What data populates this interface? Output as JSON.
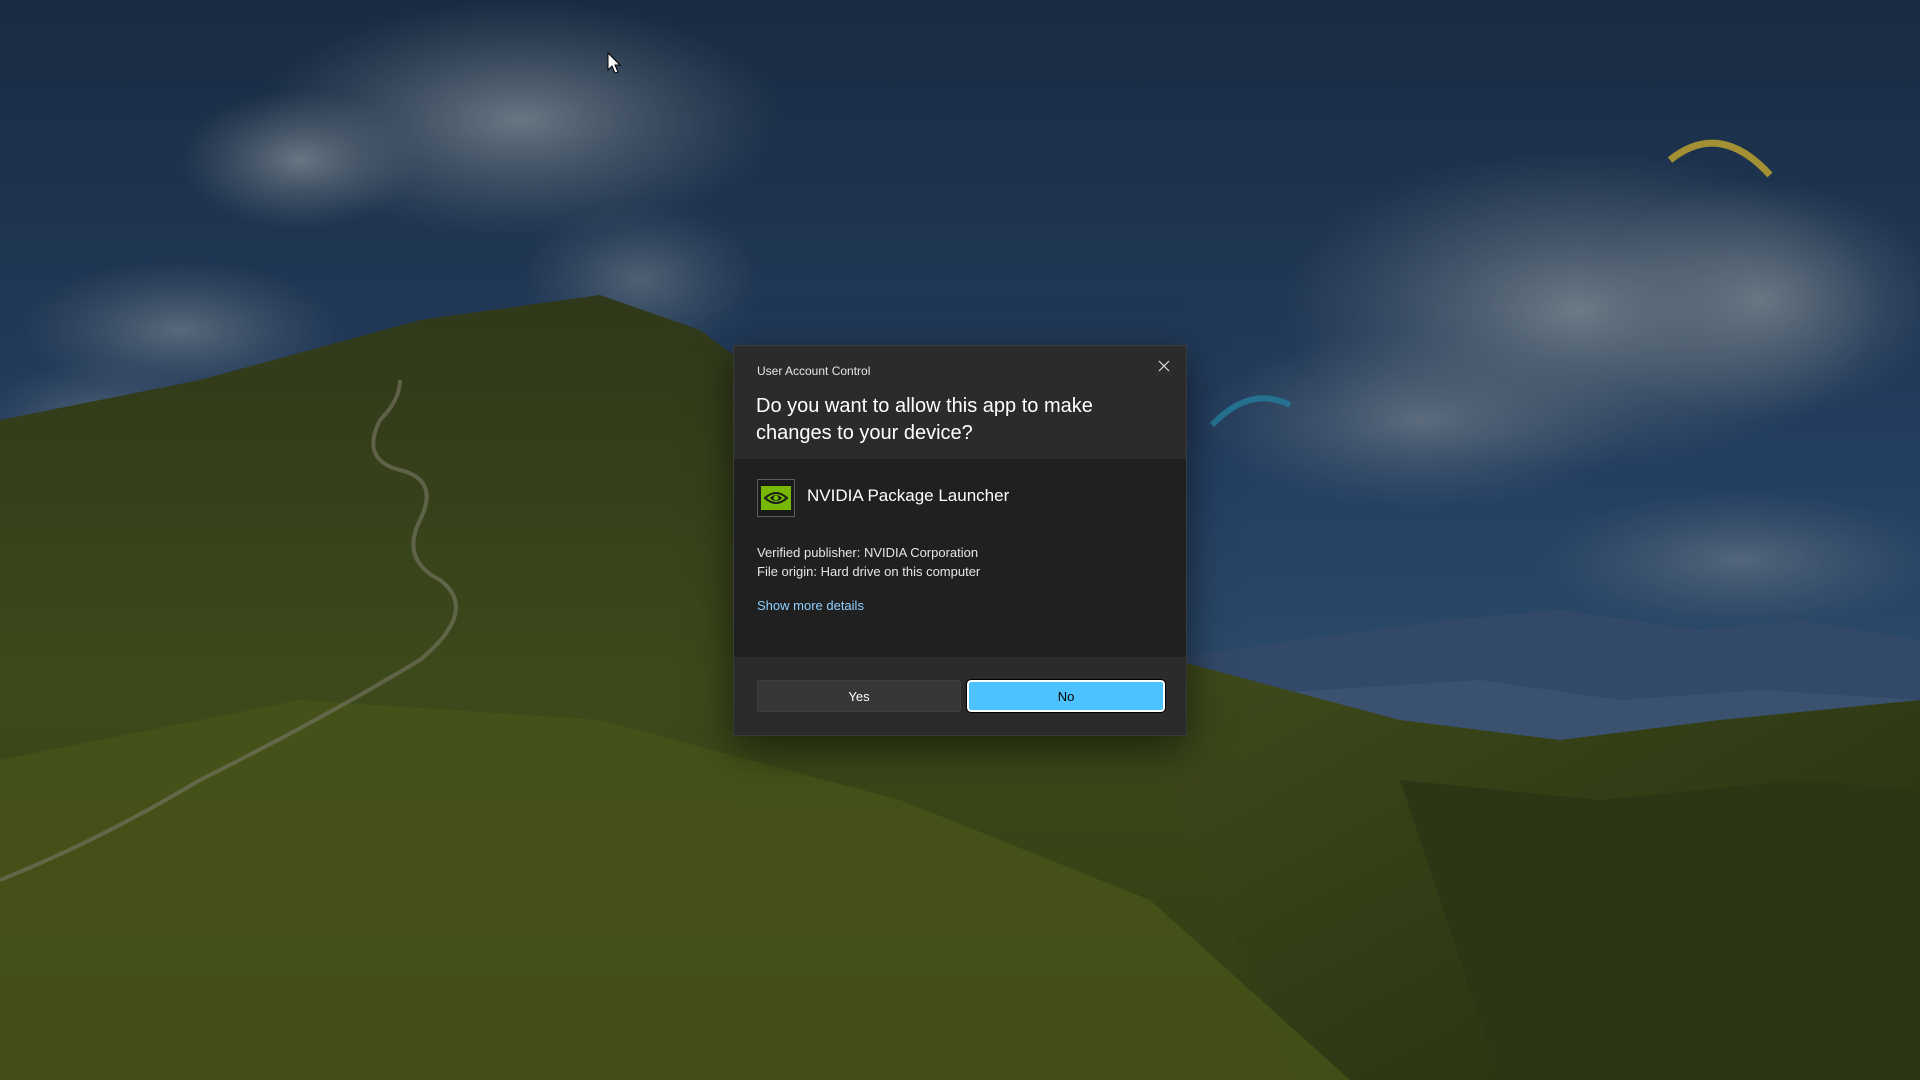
{
  "uac": {
    "window_title": "User Account Control",
    "question": "Do you want to allow this app to make changes to your device?",
    "app_name": "NVIDIA Package Launcher",
    "publisher_line": "Verified publisher: NVIDIA Corporation",
    "origin_line": "File origin: Hard drive on this computer",
    "more_details_link": "Show more details",
    "yes_label": "Yes",
    "no_label": "No",
    "close_icon": "close-icon",
    "app_icon": "nvidia-logo-icon"
  },
  "colors": {
    "accent": "#4cc2ff",
    "dialog_bg": "#2b2b2b",
    "dialog_body_bg": "#202020",
    "link": "#8fd0ff",
    "nvidia_green": "#76b900"
  }
}
